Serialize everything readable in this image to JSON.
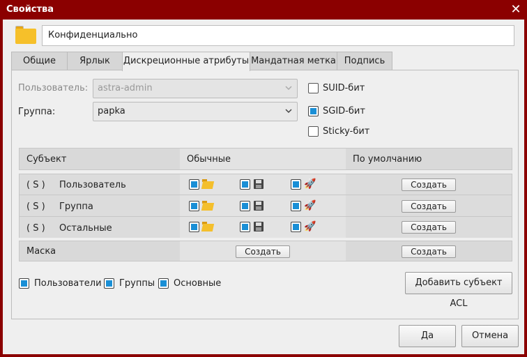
{
  "window": {
    "title": "Свойства",
    "close_glyph": "✕"
  },
  "name_field": {
    "value": "Конфиденциально"
  },
  "tabs": [
    {
      "label": "Общие"
    },
    {
      "label": "Ярлык"
    },
    {
      "label": "Дискреционные атрибуты"
    },
    {
      "label": "Мандатная метка"
    },
    {
      "label": "Подпись"
    }
  ],
  "owner": {
    "user_label": "Пользователь:",
    "user_value": "astra-admin",
    "group_label": "Группа:",
    "group_value": "papka"
  },
  "flags": {
    "suid": {
      "label": "SUID-бит",
      "checked": false
    },
    "sgid": {
      "label": "SGID-бит",
      "checked": true
    },
    "sticky": {
      "label": "Sticky-бит",
      "checked": false
    }
  },
  "acl_table": {
    "headers": {
      "subject": "Субъект",
      "regular": "Обычные",
      "default": "По умолчанию"
    },
    "rows": [
      {
        "flag": "( S )",
        "name": "Пользователь",
        "create_label": "Создать"
      },
      {
        "flag": "( S )",
        "name": "Группа",
        "create_label": "Создать"
      },
      {
        "flag": "( S )",
        "name": "Остальные",
        "create_label": "Создать"
      }
    ],
    "mask": {
      "label": "Маска",
      "create_regular_label": "Создать",
      "create_default_label": "Создать"
    }
  },
  "filters": {
    "users": {
      "label": "Пользователи",
      "checked": true
    },
    "groups": {
      "label": "Группы",
      "checked": true
    },
    "basic": {
      "label": "Основные",
      "checked": true
    }
  },
  "add_acl_label": "Добавить субъект ACL",
  "footer": {
    "ok_label": "Да",
    "cancel_label": "Отмена"
  },
  "colors": {
    "titlebar": "#8b0000",
    "checkbox_on": "#1a8fd6",
    "folder": "#f6c02a"
  }
}
